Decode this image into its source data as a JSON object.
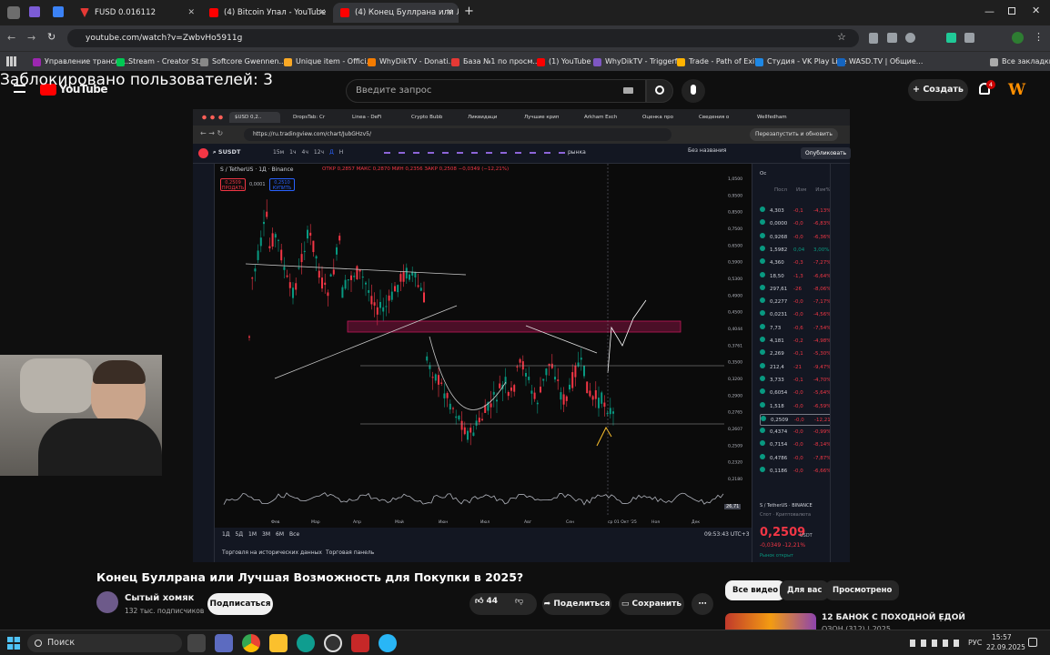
{
  "browser": {
    "tabs": [
      {
        "label": "FUSD 0.016112",
        "active": false
      },
      {
        "label": "(4) Bitcoin Упал - YouTube",
        "active": false
      },
      {
        "label": "(4) Конец Буллрана или Лу",
        "active": true
      }
    ],
    "url": "youtube.com/watch?v=ZwbvHo5911g",
    "bookmarks": [
      "Управление трансля...",
      "Stream - Creator St...",
      "Softcore Gwennen...",
      "Unique item - Offici...",
      "WhyDikTV - Donati...",
      "База №1 по просм...",
      "(1) YouTube",
      "WhyDikTV - Triggerf...",
      "Trade - Path of Exile",
      "Студия - VK Play Live",
      "WASD.TV | Общие...",
      "Все закладки"
    ]
  },
  "overlay": {
    "blocked_text": "Заблокировано пользователей: 3"
  },
  "youtube": {
    "logo": "YouTube",
    "search_placeholder": "Введите запрос",
    "create_label": "Создать",
    "notif_count": "4",
    "video_title": "Конец Буллрана или Лучшая Возможность для Покупки в 2025?",
    "channel_name": "Сытый хомяк",
    "subscribers": "132 тыс. подписчиков",
    "subscribe_label": "Подписаться",
    "likes": "44",
    "share_label": "Поделиться",
    "save_label": "Сохранить",
    "chips": [
      "Все видео",
      "Для вас",
      "Просмотрено"
    ],
    "rec_title": "12 БАНОК С ПОХОДНОЙ ЕДОЙ",
    "rec_sub": "ОЗОН (312) | 2025"
  },
  "tradingview": {
    "tabs": [
      "$USD 0,2..",
      "DropsTab: Cr",
      "Linea - DeFi",
      "Crypto Bubb",
      "Ликвидаци",
      "Лучшие крип",
      "Arkham Exch",
      "Оценка про",
      "Сведения о",
      "Wellfedham"
    ],
    "url": "https://ru.tradingview.com/chart/JubGHzv5/",
    "relaunch": "Перезапустить и обновить",
    "symbol": "SUSDT",
    "timeframes": [
      "15м",
      "1ч",
      "4ч",
      "12ч",
      "Д",
      "Н"
    ],
    "layout_name": "Без названия",
    "publish": "Опубликовать",
    "market_label": "рынка",
    "legend": "S / TetherUS · 1Д · Binance",
    "ohlc": "ОТКР 0,2857  МАКС 0,2870  МИН 0,2356  ЗАКР 0,2508  −0,0349 (−12,21%)",
    "sell_price": "0,2509",
    "sell_label": "ПРОДАТЬ",
    "spread": "0,0001",
    "buy_price": "0,2510",
    "buy_label": "КУПИТЬ",
    "x_labels": [
      "Фев",
      "Мар",
      "Апр",
      "Май",
      "Июн",
      "Июл",
      "Авг",
      "Сен",
      "ср 01 Окт '25",
      "Ноя",
      "Дек"
    ],
    "y_labels": [
      "1,0500",
      "0,9500",
      "0,8500",
      "0,7500",
      "0,6500",
      "0,5900",
      "0,5300",
      "0,4900",
      "0,4500",
      "0,4044",
      "0,3761",
      "0,3500",
      "0,3200",
      "0,2900",
      "0,2765",
      "0,2607",
      "0,2509",
      "0,2320",
      "0,2180"
    ],
    "periods": [
      "1Д",
      "5Д",
      "1М",
      "3М",
      "6М",
      "Все"
    ],
    "time": "09:53:43 UTC+3",
    "bottom_tabs": [
      "Торговля на исторических данных",
      "Торговая панель"
    ],
    "rsi_value": "26,71",
    "watch_headers": [
      "Ос",
      "Посл",
      "Изм",
      "Изм%"
    ],
    "watch_rows": [
      {
        "price": "4,303",
        "chg": "-0,1",
        "pct": "-4,13%",
        "color": "#f23645"
      },
      {
        "price": "0,0000",
        "chg": "-0,0",
        "pct": "-6,83%",
        "color": "#f23645"
      },
      {
        "price": "0,9268",
        "chg": "-0,0",
        "pct": "-6,36%",
        "color": "#f23645"
      },
      {
        "price": "1,5982",
        "chg": "0,04",
        "pct": "3,00%",
        "color": "#089981"
      },
      {
        "price": "4,360",
        "chg": "-0,3",
        "pct": "-7,27%",
        "color": "#f23645"
      },
      {
        "price": "18,50",
        "chg": "-1,3",
        "pct": "-6,64%",
        "color": "#f23645"
      },
      {
        "price": "297,61",
        "chg": "-26",
        "pct": "-8,06%",
        "color": "#f23645"
      },
      {
        "price": "0,2277",
        "chg": "-0,0",
        "pct": "-7,17%",
        "color": "#f23645"
      },
      {
        "price": "0,0231",
        "chg": "-0,0",
        "pct": "-4,56%",
        "color": "#f23645"
      },
      {
        "price": "7,73",
        "chg": "-0,6",
        "pct": "-7,54%",
        "color": "#f23645"
      },
      {
        "price": "4,181",
        "chg": "-0,2",
        "pct": "-4,98%",
        "color": "#f23645"
      },
      {
        "price": "2,269",
        "chg": "-0,1",
        "pct": "-5,30%",
        "color": "#f23645"
      },
      {
        "price": "212,4",
        "chg": "-21",
        "pct": "-9,47%",
        "color": "#f23645"
      },
      {
        "price": "3,733",
        "chg": "-0,1",
        "pct": "-4,70%",
        "color": "#f23645"
      },
      {
        "price": "0,6054",
        "chg": "-0,0",
        "pct": "-5,64%",
        "color": "#f23645"
      },
      {
        "price": "1,518",
        "chg": "-0,0",
        "pct": "-6,59%",
        "color": "#f23645"
      },
      {
        "price": "0,2509",
        "chg": "-0,0",
        "pct": "-12,21%",
        "color": "#f23645"
      },
      {
        "price": "0,4374",
        "chg": "-0,0",
        "pct": "-0,99%",
        "color": "#f23645"
      },
      {
        "price": "0,7154",
        "chg": "-0,0",
        "pct": "-8,14%",
        "color": "#f23645"
      },
      {
        "price": "0,4786",
        "chg": "-0,0",
        "pct": "-7,87%",
        "color": "#f23645"
      },
      {
        "price": "0,1186",
        "chg": "-0,0",
        "pct": "-6,66%",
        "color": "#f23645"
      }
    ],
    "detail_symbol": "S / TetherUS",
    "detail_exchange": "BINANCE",
    "detail_type": "Спот · Криптовалюта",
    "detail_price": "0,2509",
    "detail_currency": "USDT",
    "detail_change": "-0,0349 -12,21%",
    "detail_status": "Рынок открыт"
  },
  "taskbar": {
    "search": "Поиск",
    "lang": "РУС",
    "time": "15:57",
    "date": "22.09.2025"
  },
  "colors": {
    "yt_red": "#ff0000",
    "tv_bg": "#131722",
    "up": "#089981",
    "down": "#f23645",
    "zone": "#c2185b"
  }
}
